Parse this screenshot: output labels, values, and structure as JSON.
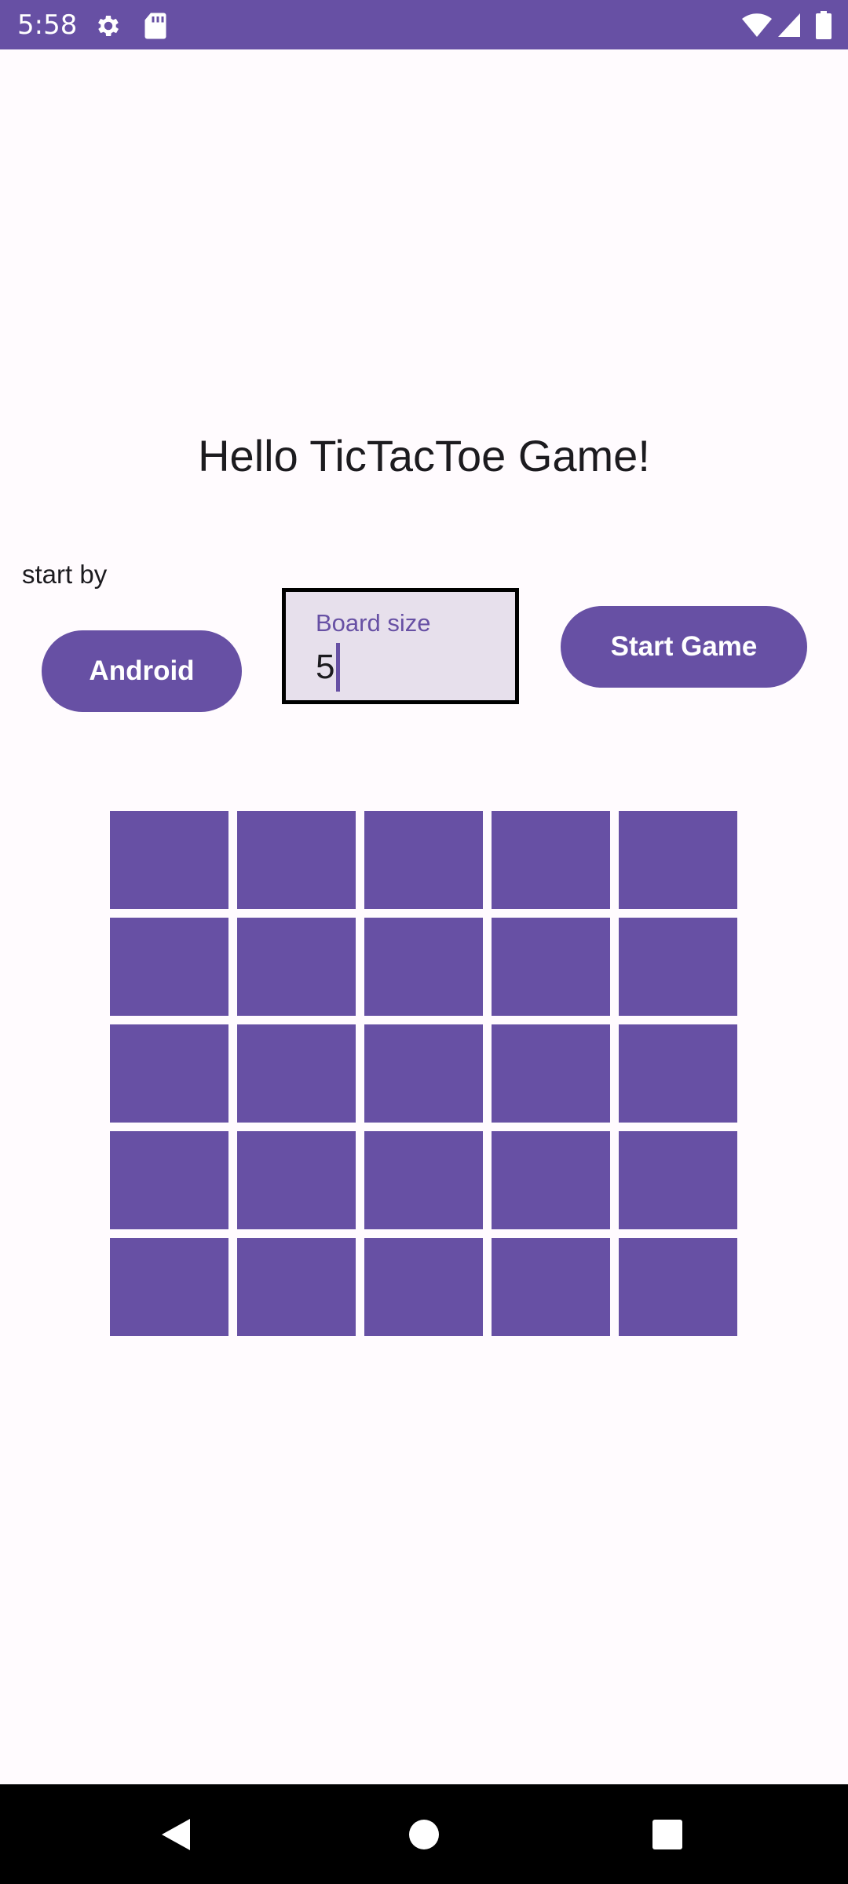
{
  "status_bar": {
    "time": "5:58",
    "icons": [
      "gear-icon",
      "sd-card-icon",
      "wifi-icon",
      "signal-icon",
      "battery-icon"
    ]
  },
  "main": {
    "title": "Hello TicTacToe Game!",
    "start_by_label": "start by",
    "start_player_button": "Android",
    "board_size_field": {
      "label": "Board size",
      "value": "5"
    },
    "start_game_button": "Start Game"
  },
  "board": {
    "size": 5,
    "cells": [
      [
        "",
        "",
        "",
        "",
        ""
      ],
      [
        "",
        "",
        "",
        "",
        ""
      ],
      [
        "",
        "",
        "",
        "",
        ""
      ],
      [
        "",
        "",
        "",
        "",
        ""
      ],
      [
        "",
        "",
        "",
        "",
        ""
      ]
    ]
  },
  "nav_bar": {
    "icons": [
      "back-icon",
      "home-icon",
      "recents-icon"
    ]
  },
  "colors": {
    "primary": "#6750a4",
    "background": "#fffbfe",
    "field_background": "#e7e0ec",
    "on_primary": "#ffffff",
    "text": "#1c1b1f"
  }
}
